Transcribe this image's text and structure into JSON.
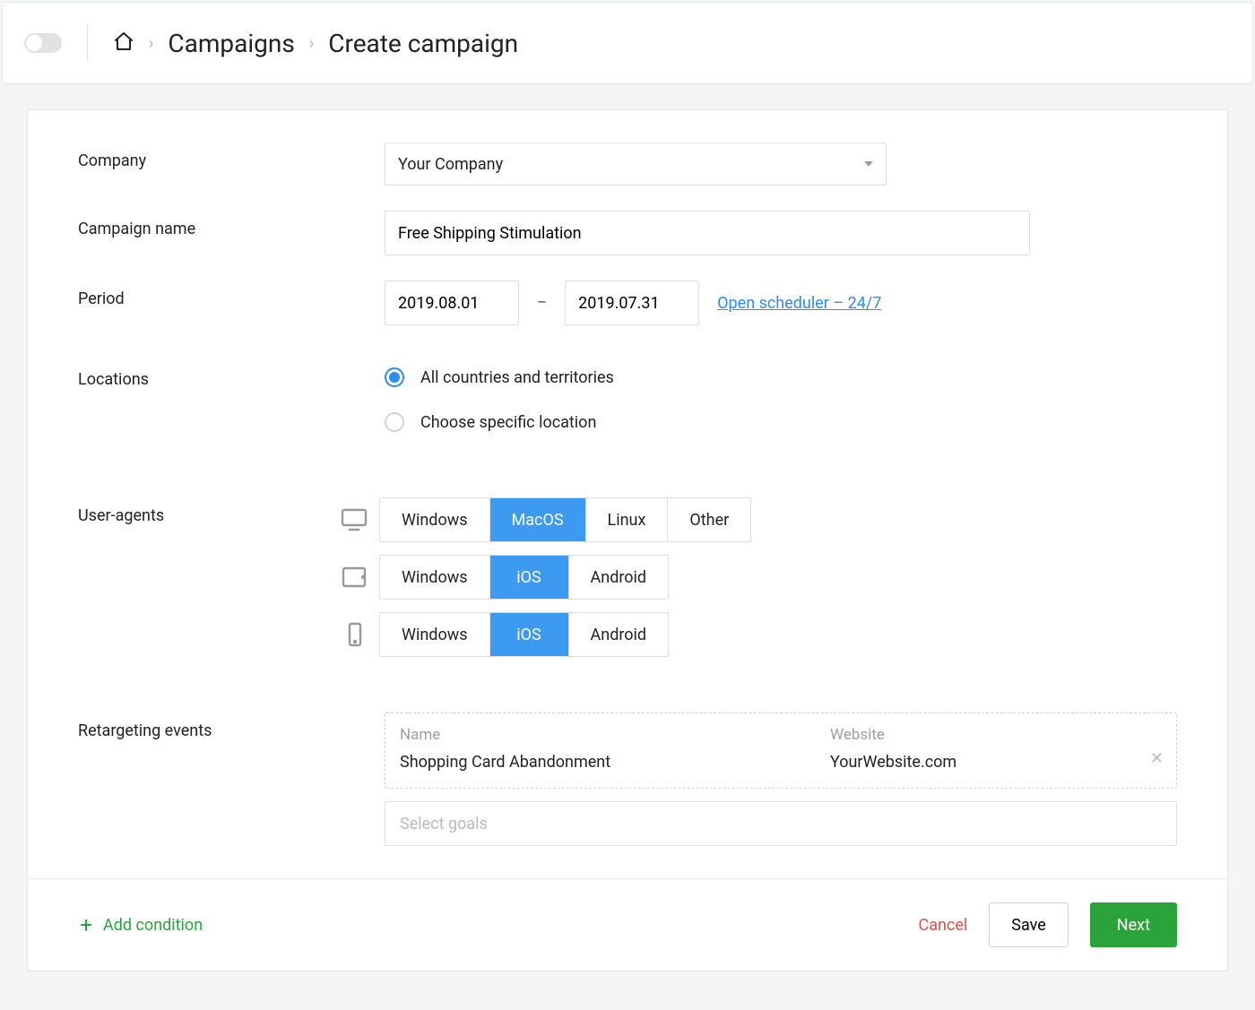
{
  "breadcrumb": {
    "campaigns": "Campaigns",
    "current": "Create campaign"
  },
  "form": {
    "company_label": "Company",
    "company_value": "Your Company",
    "campaign_name_label": "Campaign name",
    "campaign_name_value": "Free Shipping Stimulation",
    "period_label": "Period",
    "period_from": "2019.08.01",
    "period_dash": "–",
    "period_to": "2019.07.31",
    "scheduler_link": "Open scheduler – 24/7",
    "locations_label": "Locations",
    "locations_opt_all": "All countries and territories",
    "locations_opt_specific": "Choose specific location",
    "user_agents_label": "User-agents",
    "ua_desktop": {
      "windows": "Windows",
      "macos": "MacOS",
      "linux": "Linux",
      "other": "Other"
    },
    "ua_tablet": {
      "windows": "Windows",
      "ios": "iOS",
      "android": "Android"
    },
    "ua_mobile": {
      "windows": "Windows",
      "ios": "iOS",
      "android": "Android"
    },
    "retarget_label": "Retargeting events",
    "retarget_header_name": "Name",
    "retarget_header_website": "Website",
    "retarget_event_name": "Shopping Card Abandonment",
    "retarget_event_website": "YourWebsite.com",
    "retarget_goals_placeholder": "Select goals"
  },
  "footer": {
    "add_condition": "Add condition",
    "cancel": "Cancel",
    "save": "Save",
    "next": "Next"
  }
}
